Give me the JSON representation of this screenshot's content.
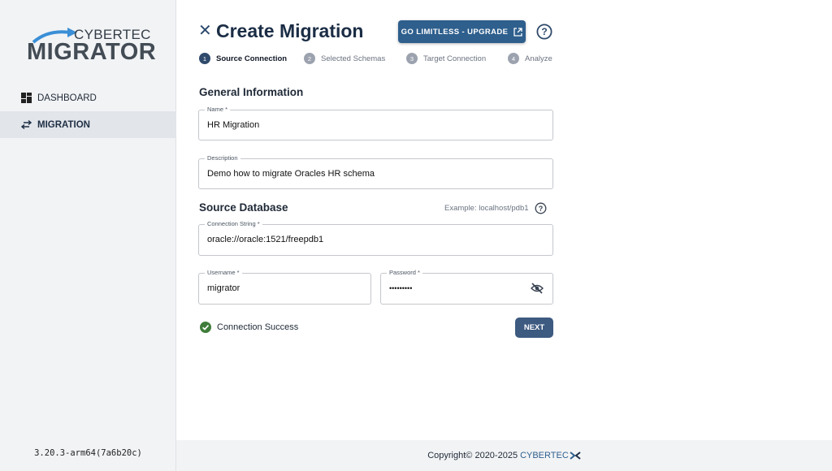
{
  "sidebar": {
    "logo": {
      "top": "CYBERTEC",
      "main": "MIGRATOR"
    },
    "items": [
      {
        "label": "DASHBOARD",
        "icon": "dashboard-icon"
      },
      {
        "label": "MIGRATION",
        "icon": "swap-arrows-icon",
        "active": true
      }
    ],
    "version": "3.20.3-arm64(7a6b20c)"
  },
  "header": {
    "title": "Create Migration",
    "upgrade_label": "GO LIMITLESS - UPGRADE",
    "close_icon": "close-icon",
    "help_icon": "help-circle-icon"
  },
  "stepper": {
    "steps": [
      {
        "num": "1",
        "label": "Source Connection",
        "active": true
      },
      {
        "num": "2",
        "label": "Selected Schemas"
      },
      {
        "num": "3",
        "label": "Target Connection"
      },
      {
        "num": "4",
        "label": "Analyze"
      }
    ]
  },
  "general": {
    "title": "General Information",
    "name_label": "Name *",
    "name_value": "HR Migration",
    "description_label": "Description",
    "description_value": "Demo how to migrate Oracles HR schema"
  },
  "source": {
    "title": "Source Database",
    "example": "Example: localhost/pdb1",
    "conn_label": "Connection String *",
    "conn_value": "oracle://oracle:1521/freepdb1",
    "username_label": "Username *",
    "username_value": "migrator",
    "password_label": "Password *",
    "password_value": "•••••••••"
  },
  "status": {
    "text": "Connection Success",
    "color": "#3f7d3a"
  },
  "next_label": "NEXT",
  "footer": {
    "copyright": "Copyright© 2020-2025",
    "brand": "CYBERTEC"
  },
  "colors": {
    "accent": "#2e5f8d",
    "title": "#1b2d45",
    "button": "#3d5a80",
    "sidebar_bg": "#f2f3f5"
  }
}
